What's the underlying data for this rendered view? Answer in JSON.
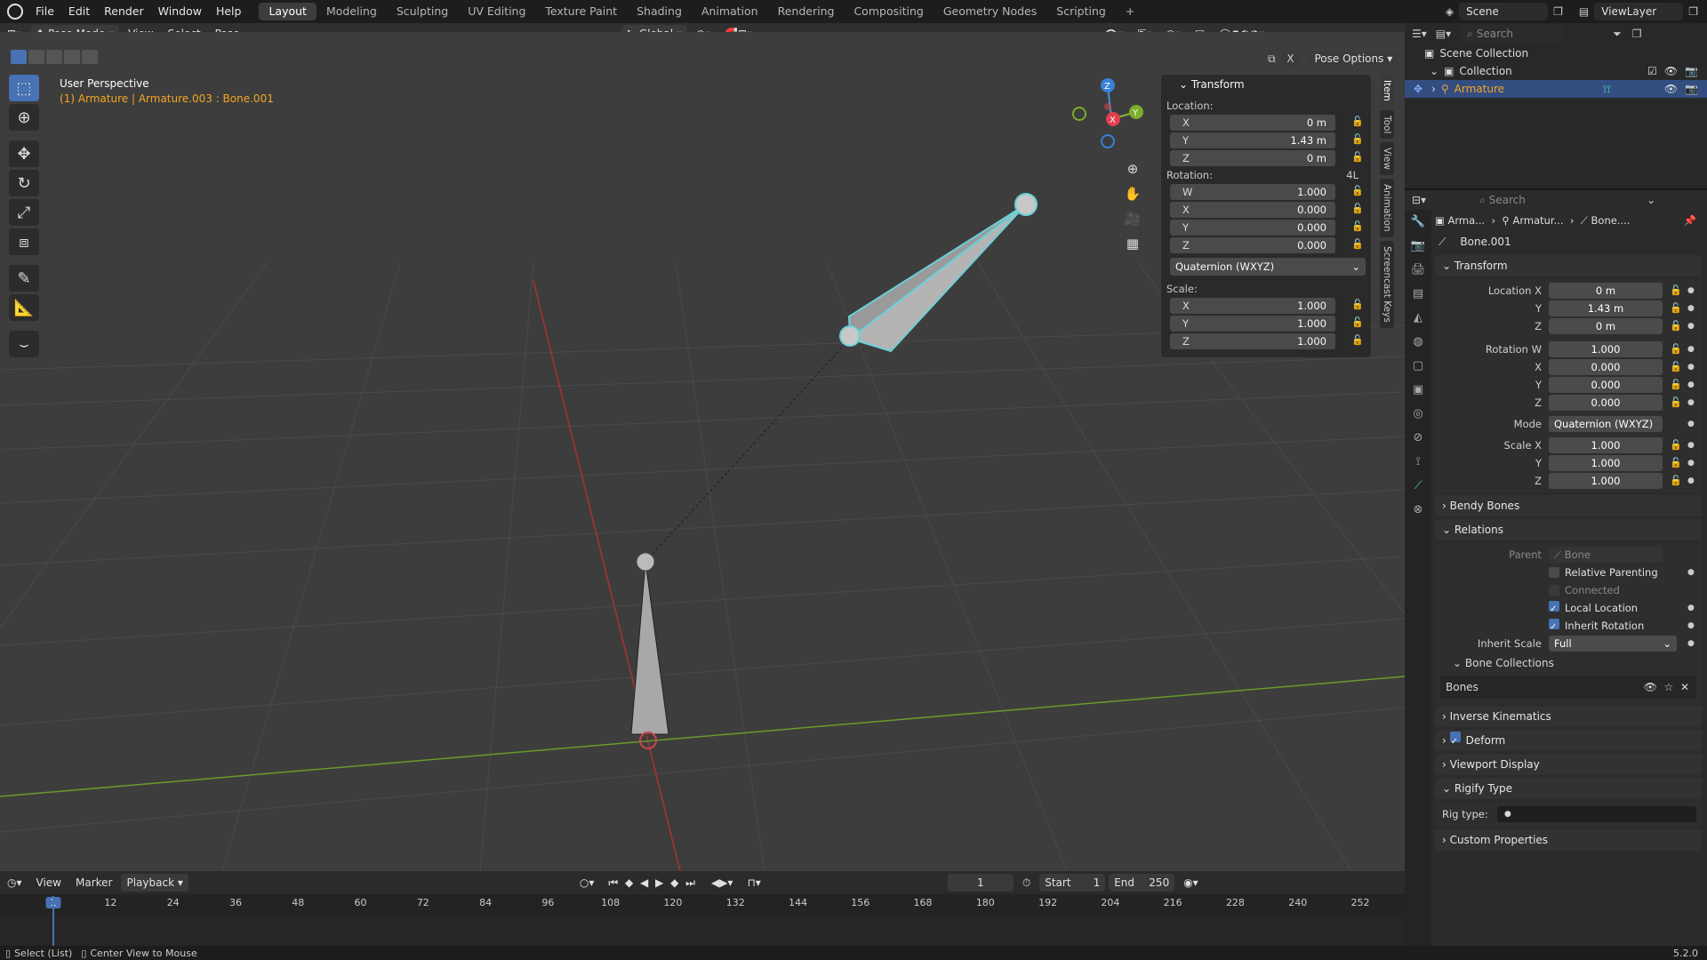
{
  "topbar": {
    "menus": [
      "File",
      "Edit",
      "Render",
      "Window",
      "Help"
    ],
    "workspaces": [
      "Layout",
      "Modeling",
      "Sculpting",
      "UV Editing",
      "Texture Paint",
      "Shading",
      "Animation",
      "Rendering",
      "Compositing",
      "Geometry Nodes",
      "Scripting"
    ],
    "active_workspace": "Layout",
    "add_tab": "+",
    "scene": "Scene",
    "view_layer": "ViewLayer"
  },
  "viewport_header": {
    "mode": "Pose Mode",
    "view": "View",
    "select": "Select",
    "pose": "Pose",
    "transform_orientation": "Global",
    "pose_options": "Pose Options",
    "x_label": "X"
  },
  "viewport": {
    "perspective": "User Perspective",
    "selection": "(1) Armature | Armature.003 : Bone.001",
    "gizmo": {
      "z": "Z",
      "x": "X",
      "y": "Y"
    }
  },
  "npanel": {
    "title": "Transform",
    "location_label": "Location:",
    "location": [
      {
        "axis": "X",
        "value": "0 m"
      },
      {
        "axis": "Y",
        "value": "1.43 m"
      },
      {
        "axis": "Z",
        "value": "0 m"
      }
    ],
    "rotation_label": "Rotation:",
    "rotation_mode_short": "4L",
    "rotation": [
      {
        "axis": "W",
        "value": "1.000"
      },
      {
        "axis": "X",
        "value": "0.000"
      },
      {
        "axis": "Y",
        "value": "0.000"
      },
      {
        "axis": "Z",
        "value": "0.000"
      }
    ],
    "rotation_mode": "Quaternion (WXYZ)",
    "scale_label": "Scale:",
    "scale": [
      {
        "axis": "X",
        "value": "1.000"
      },
      {
        "axis": "Y",
        "value": "1.000"
      },
      {
        "axis": "Z",
        "value": "1.000"
      }
    ]
  },
  "side_tabs": [
    "Item",
    "Tool",
    "View",
    "Animation",
    "Screencast Keys"
  ],
  "timeline": {
    "view": "View",
    "marker": "Marker",
    "playback": "Playback",
    "current_frame": "1",
    "start_label": "Start",
    "start": "1",
    "end_label": "End",
    "end": "250",
    "ticks": [
      "1",
      "12",
      "24",
      "36",
      "48",
      "60",
      "72",
      "84",
      "96",
      "108",
      "120",
      "132",
      "144",
      "156",
      "168",
      "180",
      "192",
      "204",
      "216",
      "228",
      "240",
      "252"
    ]
  },
  "statusbar": {
    "left1": "Select (List)",
    "left2": "Center View to Mouse",
    "version": "5.2.0"
  },
  "outliner": {
    "search_placeholder": "Search",
    "scene_collection": "Scene Collection",
    "collection": "Collection",
    "armature": "Armature"
  },
  "properties": {
    "search_placeholder": "Search",
    "breadcrumb": [
      "Arma...",
      "Armatur...",
      "Bone...."
    ],
    "bone_name": "Bone.001",
    "transform": {
      "title": "Transform",
      "location_x_label": "Location X",
      "y_label": "Y",
      "z_label": "Z",
      "location": [
        "0 m",
        "1.43 m",
        "0 m"
      ],
      "rotation_w_label": "Rotation W",
      "x_label": "X",
      "rotation": [
        "1.000",
        "0.000",
        "0.000",
        "0.000"
      ],
      "mode_label": "Mode",
      "mode": "Quaternion (WXYZ)",
      "scale_x_label": "Scale X",
      "scale": [
        "1.000",
        "1.000",
        "1.000"
      ]
    },
    "bendy_bones": "Bendy Bones",
    "relations": "Relations",
    "parent_label": "Parent",
    "parent": "Bone",
    "relative_parenting": "Relative Parenting",
    "connected": "Connected",
    "local_location": "Local Location",
    "inherit_rotation": "Inherit Rotation",
    "inherit_scale_label": "Inherit Scale",
    "inherit_scale": "Full",
    "bone_collections": "Bone Collections",
    "bones": "Bones",
    "inverse_kinematics": "Inverse Kinematics",
    "deform": "Deform",
    "viewport_display": "Viewport Display",
    "rigify_type": "Rigify Type",
    "rig_type_label": "Rig type:",
    "custom_properties": "Custom Properties"
  }
}
